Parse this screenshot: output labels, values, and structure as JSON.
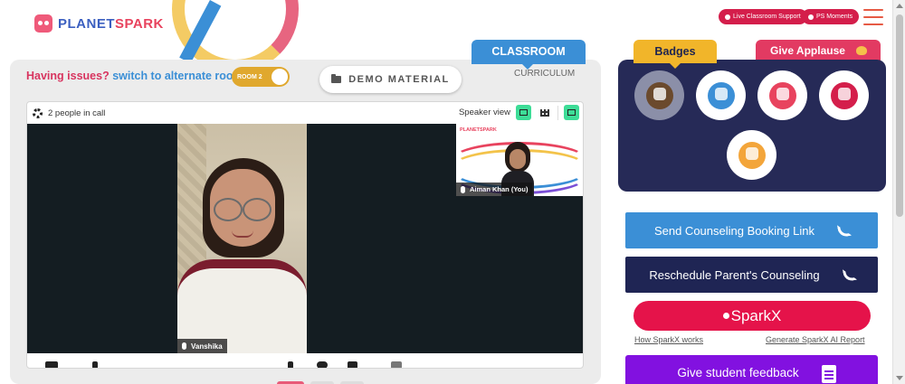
{
  "brand": {
    "part1": "PLANET",
    "part2": "SPARK"
  },
  "header": {
    "support_label": "Live Classroom Support",
    "moments_label": "PS Moments"
  },
  "classroom": {
    "issues_text": "Having issues?",
    "switch_text": "switch to alternate room",
    "room_toggle_label": "ROOM 2",
    "demo_material_label": "DEMO MATERIAL",
    "tab_classroom": "CLASSROOM",
    "tab_curriculum": "CURRICULUM"
  },
  "call": {
    "people_count": "2 people in call",
    "view_label": "Speaker view",
    "main_participant": "Vanshika",
    "thumb_participant": "Aiman Khan (You)",
    "thumb_brand": "PLANETSPARK"
  },
  "badges": {
    "tab_label": "Badges",
    "applause_label": "Give Applause",
    "items": [
      "trophy-badge",
      "superhero-badge",
      "meditation-badge",
      "idea-badge",
      "robot-badge"
    ]
  },
  "actions": {
    "send_counseling": "Send Counseling Booking Link",
    "reschedule_counseling": "Reschedule Parent's Counseling",
    "sparkx": "SparkX",
    "how_sparkx": "How SparkX works",
    "generate_sparkx": "Generate SparkX AI Report",
    "give_feedback": "Give student feedback"
  },
  "colors": {
    "accent_red": "#e5134a",
    "accent_blue": "#3b8fd6",
    "navy": "#262a57",
    "purple": "#8211e0",
    "toggle_gold": "#e0a82e"
  }
}
